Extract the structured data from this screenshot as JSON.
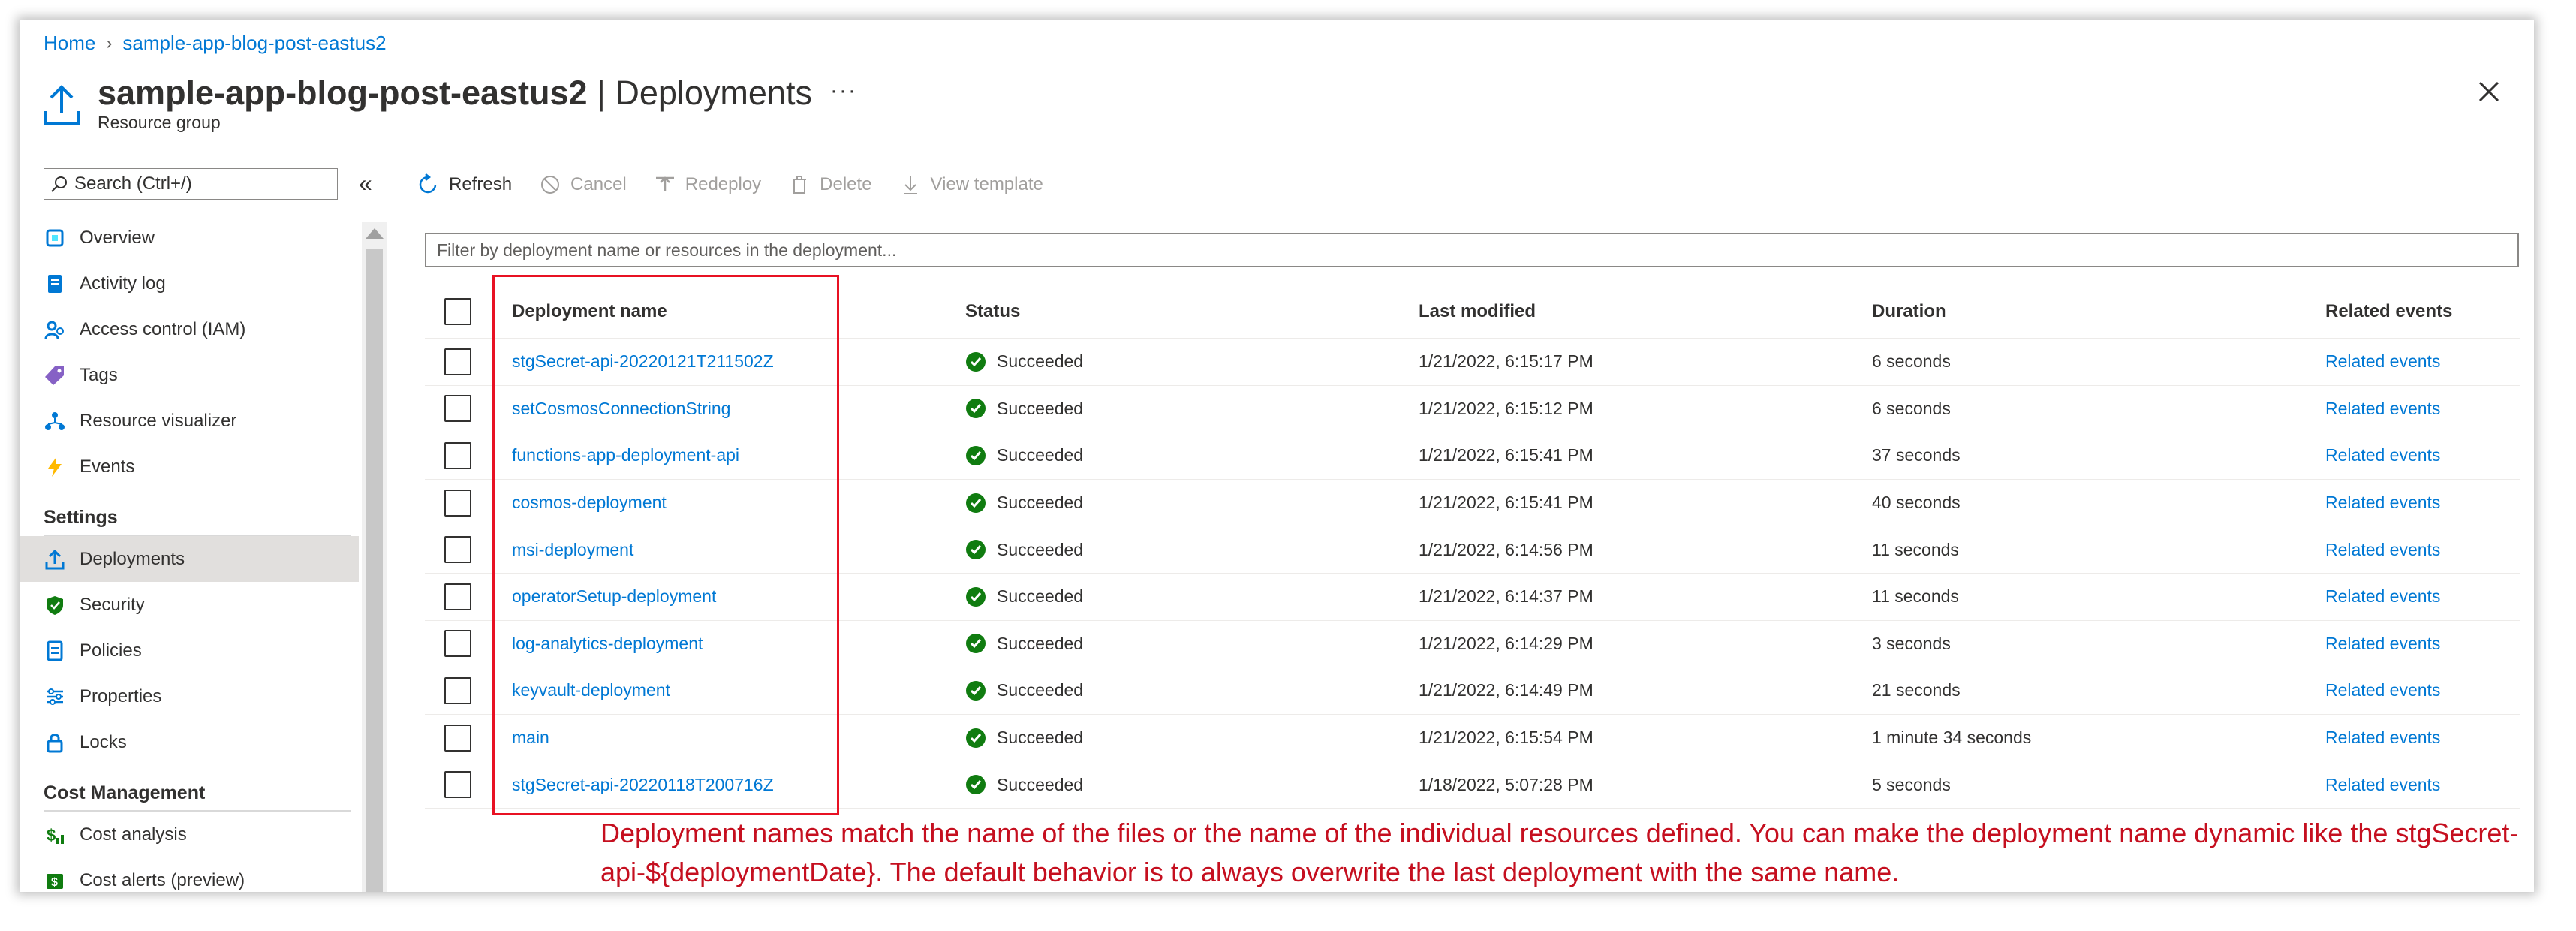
{
  "breadcrumb": {
    "home": "Home",
    "separator": "›",
    "current": "sample-app-blog-post-eastus2"
  },
  "header": {
    "resource_name": "sample-app-blog-post-eastus2",
    "divider": "|",
    "page_name": "Deployments",
    "subtitle": "Resource group",
    "more": "···"
  },
  "sidebar": {
    "search_placeholder": "Search (Ctrl+/)",
    "collapse": "«",
    "items_top": [
      {
        "label": "Overview",
        "icon": "overview-icon"
      },
      {
        "label": "Activity log",
        "icon": "activity-log-icon"
      },
      {
        "label": "Access control (IAM)",
        "icon": "access-control-icon"
      },
      {
        "label": "Tags",
        "icon": "tag-icon"
      },
      {
        "label": "Resource visualizer",
        "icon": "resource-visualizer-icon"
      },
      {
        "label": "Events",
        "icon": "events-icon"
      }
    ],
    "section_settings": "Settings",
    "items_settings": [
      {
        "label": "Deployments",
        "icon": "deployments-icon",
        "selected": true
      },
      {
        "label": "Security",
        "icon": "security-icon"
      },
      {
        "label": "Policies",
        "icon": "policies-icon"
      },
      {
        "label": "Properties",
        "icon": "properties-icon"
      },
      {
        "label": "Locks",
        "icon": "lock-icon"
      }
    ],
    "section_cost": "Cost Management",
    "items_cost": [
      {
        "label": "Cost analysis",
        "icon": "cost-analysis-icon"
      },
      {
        "label": "Cost alerts (preview)",
        "icon": "cost-alerts-icon"
      }
    ]
  },
  "toolbar": {
    "refresh": "Refresh",
    "cancel": "Cancel",
    "redeploy": "Redeploy",
    "delete": "Delete",
    "view_template": "View template"
  },
  "filter_placeholder": "Filter by deployment name or resources in the deployment...",
  "table": {
    "columns": [
      "Deployment name",
      "Status",
      "Last modified",
      "Duration",
      "Related events"
    ],
    "rows": [
      {
        "name": "stgSecret-api-20220121T211502Z",
        "status": "Succeeded",
        "modified": "1/21/2022, 6:15:17 PM",
        "duration": "6 seconds",
        "events": "Related events"
      },
      {
        "name": "setCosmosConnectionString",
        "status": "Succeeded",
        "modified": "1/21/2022, 6:15:12 PM",
        "duration": "6 seconds",
        "events": "Related events"
      },
      {
        "name": "functions-app-deployment-api",
        "status": "Succeeded",
        "modified": "1/21/2022, 6:15:41 PM",
        "duration": "37 seconds",
        "events": "Related events"
      },
      {
        "name": "cosmos-deployment",
        "status": "Succeeded",
        "modified": "1/21/2022, 6:15:41 PM",
        "duration": "40 seconds",
        "events": "Related events"
      },
      {
        "name": "msi-deployment",
        "status": "Succeeded",
        "modified": "1/21/2022, 6:14:56 PM",
        "duration": "11 seconds",
        "events": "Related events"
      },
      {
        "name": "operatorSetup-deployment",
        "status": "Succeeded",
        "modified": "1/21/2022, 6:14:37 PM",
        "duration": "11 seconds",
        "events": "Related events"
      },
      {
        "name": "log-analytics-deployment",
        "status": "Succeeded",
        "modified": "1/21/2022, 6:14:29 PM",
        "duration": "3 seconds",
        "events": "Related events"
      },
      {
        "name": "keyvault-deployment",
        "status": "Succeeded",
        "modified": "1/21/2022, 6:14:49 PM",
        "duration": "21 seconds",
        "events": "Related events"
      },
      {
        "name": "main",
        "status": "Succeeded",
        "modified": "1/21/2022, 6:15:54 PM",
        "duration": "1 minute 34 seconds",
        "events": "Related events"
      },
      {
        "name": "stgSecret-api-20220118T200716Z",
        "status": "Succeeded",
        "modified": "1/18/2022, 5:07:28 PM",
        "duration": "5 seconds",
        "events": "Related events"
      }
    ]
  },
  "annotation": "Deployment names match the name of the files or the name of the individual resources defined. You can make the deployment name dynamic like the stgSecret-api-${deploymentDate}. The default behavior is to always overwrite the last deployment with the same name.",
  "colors": {
    "link": "#0078d4",
    "success": "#107c10",
    "annotation": "#c50f1f",
    "highlight": "#e81123"
  }
}
